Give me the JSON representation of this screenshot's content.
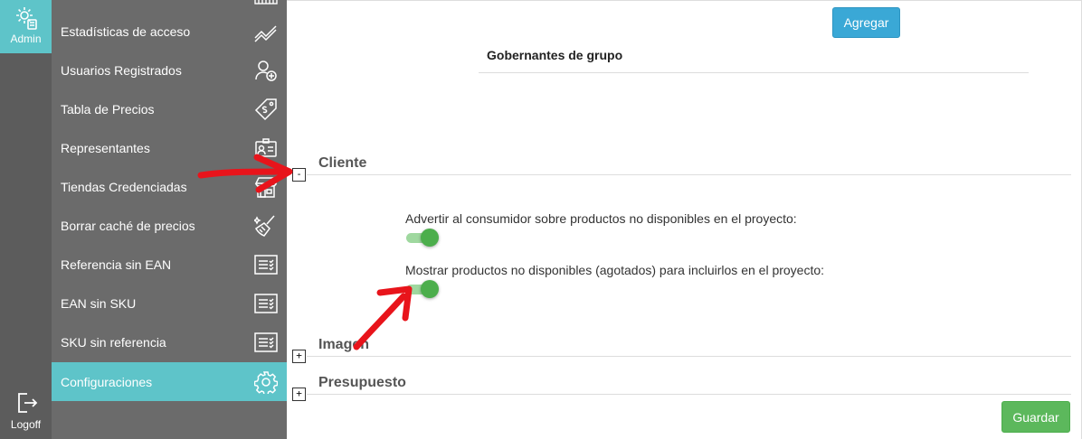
{
  "rail": {
    "admin_label": "Admin",
    "logoff_label": "Logoff"
  },
  "menu": {
    "items": [
      {
        "label": "Estadísticas de acceso",
        "icon": "chart-line-icon"
      },
      {
        "label": "Usuarios Registrados",
        "icon": "add-user-icon"
      },
      {
        "label": "Tabla de Precios",
        "icon": "price-tag-icon"
      },
      {
        "label": "Representantes",
        "icon": "id-card-icon"
      },
      {
        "label": "Tiendas Credenciadas",
        "icon": "store-icon"
      },
      {
        "label": "Borrar caché de precios",
        "icon": "broom-icon"
      },
      {
        "label": "Referencia sin EAN",
        "icon": "checklist-icon"
      },
      {
        "label": "EAN sin SKU",
        "icon": "checklist-icon"
      },
      {
        "label": "SKU sin referencia",
        "icon": "checklist-icon"
      },
      {
        "label": "Configuraciones",
        "icon": "gear-icon",
        "active": true
      }
    ]
  },
  "main": {
    "agregar_label": "Agregar",
    "group_header": "Gobernantes de grupo",
    "sections": [
      {
        "toggle": "-",
        "title": "Cliente",
        "expanded": true
      },
      {
        "toggle": "+",
        "title": "Imagen",
        "expanded": false
      },
      {
        "toggle": "+",
        "title": "Presupuesto",
        "expanded": false
      }
    ],
    "options": [
      {
        "label": "Advertir al consumidor sobre productos no disponibles en el proyecto:",
        "enabled": true
      },
      {
        "label": "Mostrar productos no disponibles (agotados) para incluirlos en el proyecto:",
        "enabled": true
      }
    ],
    "guardar_label": "Guardar"
  },
  "colors": {
    "accent": "#5ec4c9",
    "menu_bg": "#6b6b6b",
    "rail_bg": "#5c5c5c",
    "agregar": "#3aa8d6",
    "guardar": "#5cb85c",
    "switch_on": "#4cae4c",
    "annotation_arrow": "#e8141b"
  }
}
